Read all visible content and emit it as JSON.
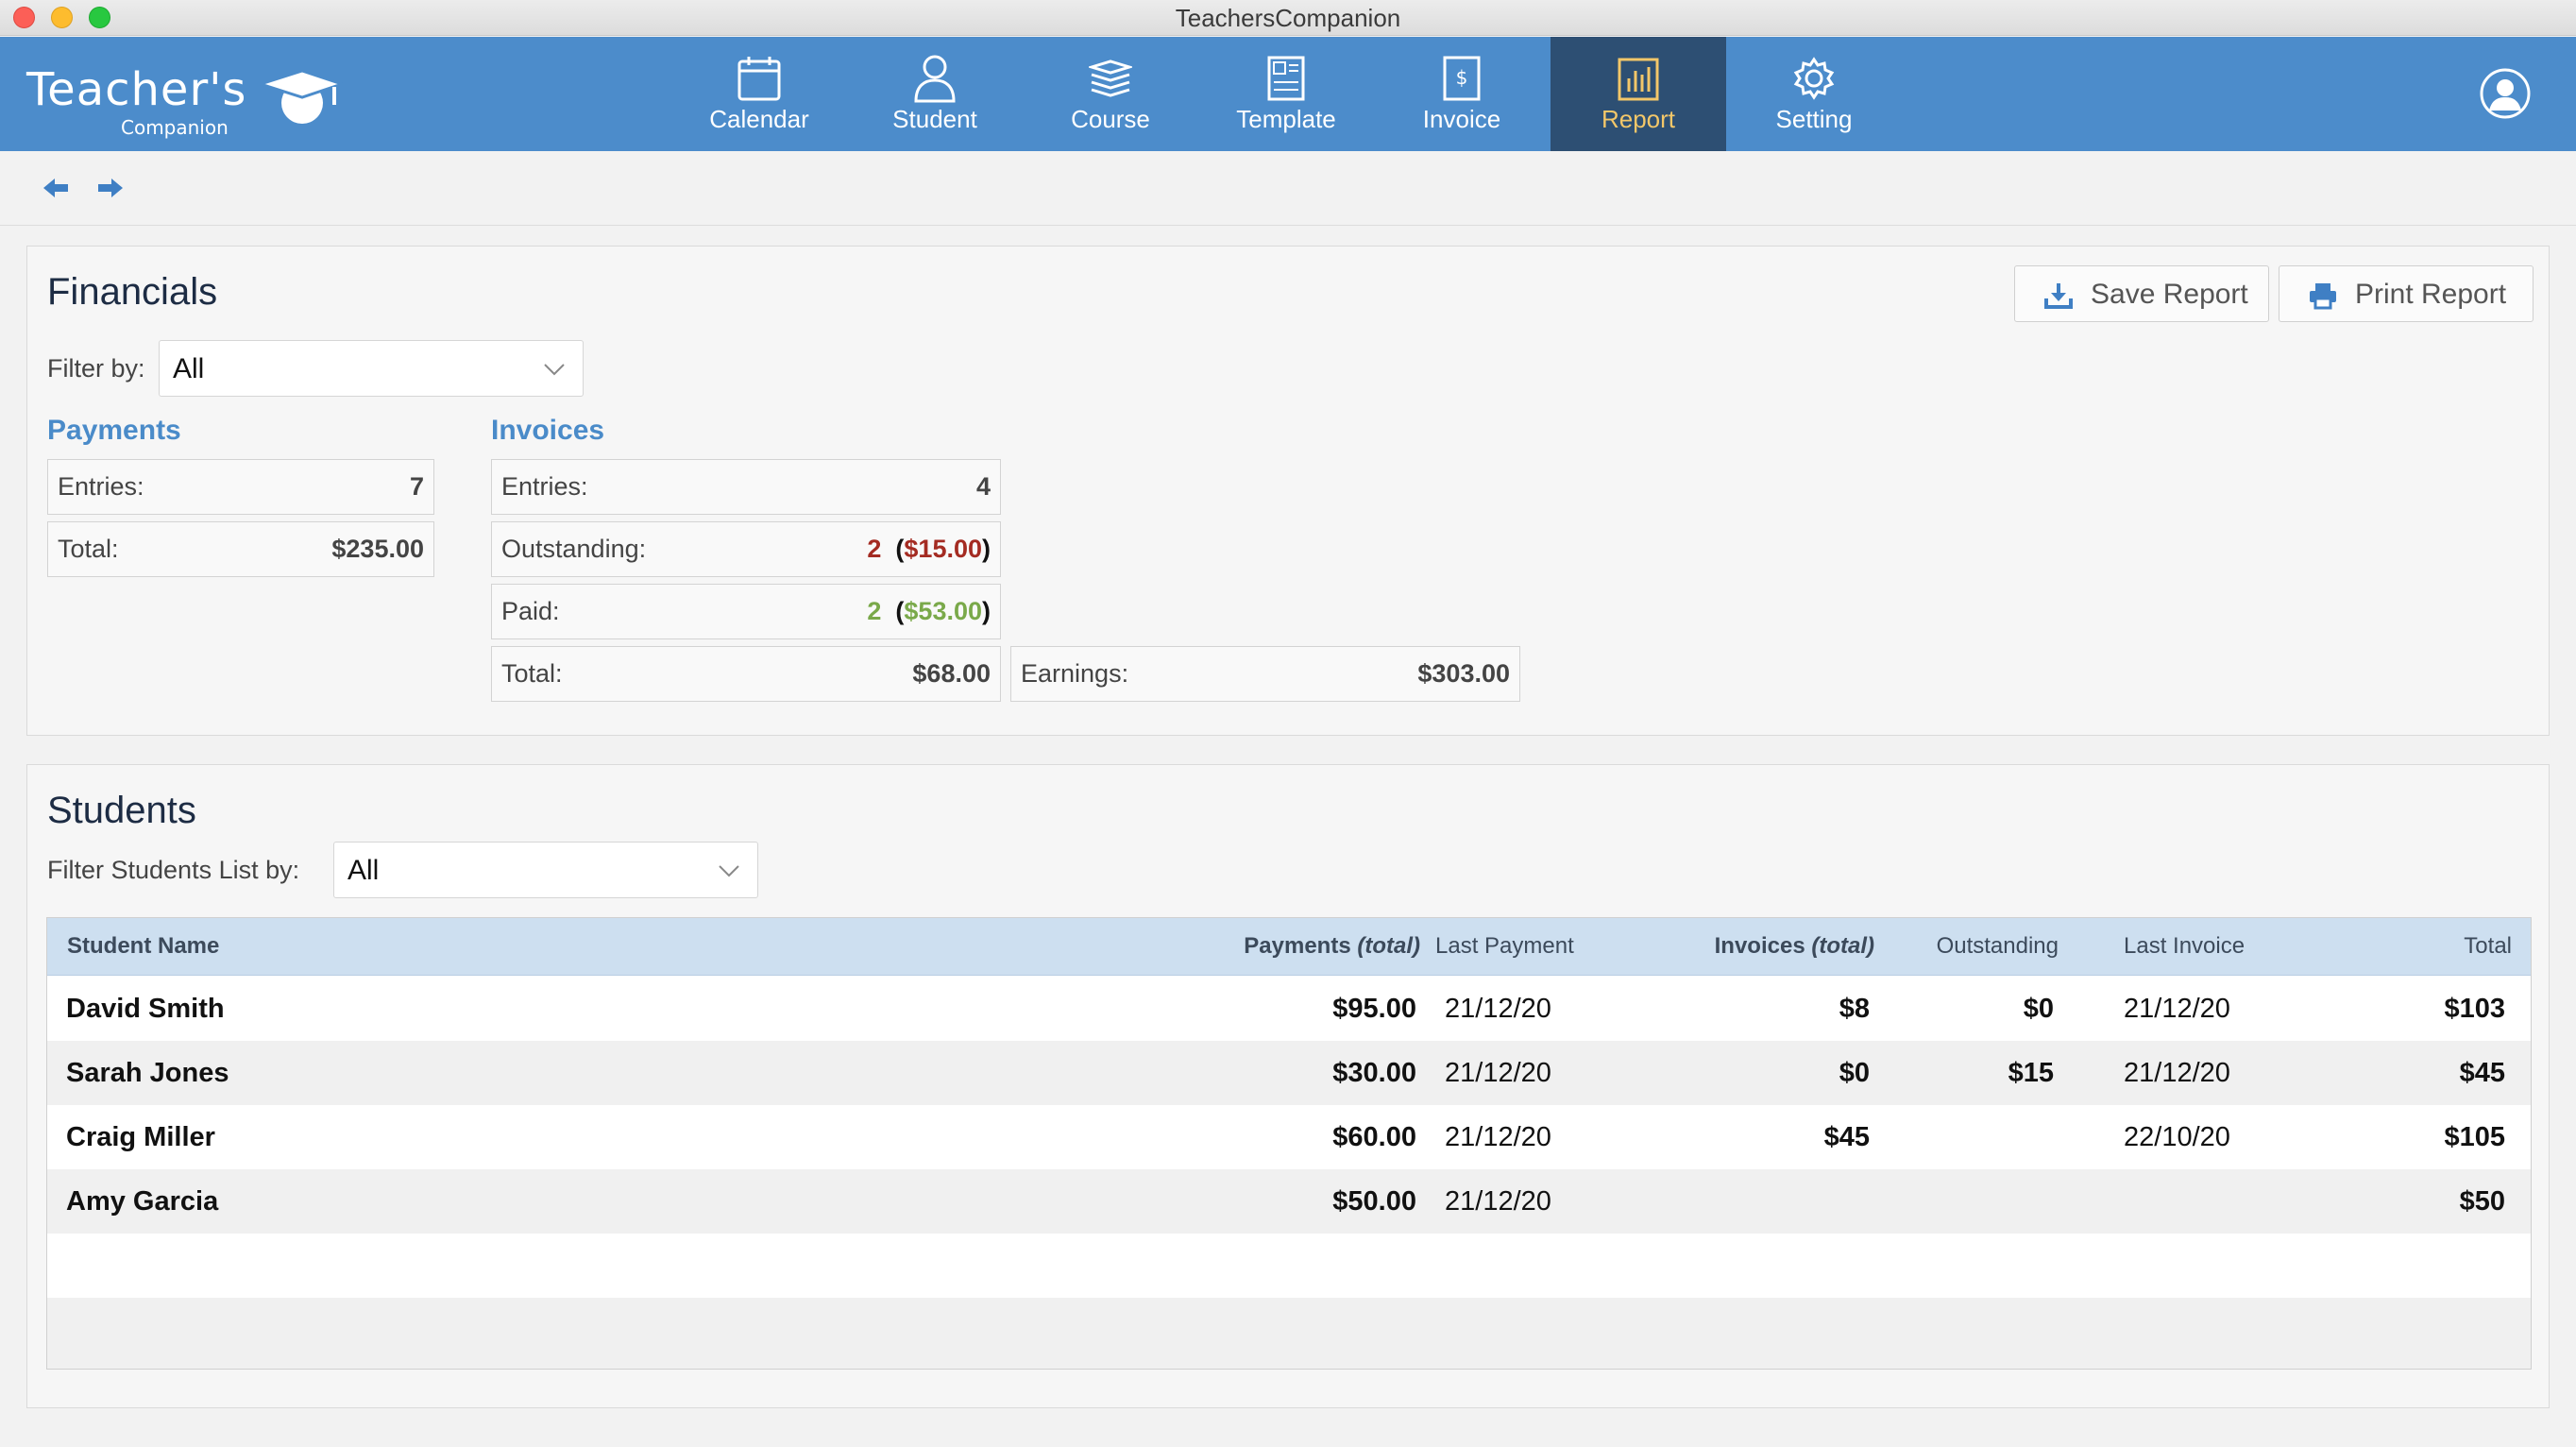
{
  "window": {
    "title": "TeachersCompanion"
  },
  "logo": {
    "main": "Teacher's",
    "sub": "Companion"
  },
  "nav": {
    "items": [
      {
        "label": "Calendar",
        "icon": "calendar-icon"
      },
      {
        "label": "Student",
        "icon": "person-icon"
      },
      {
        "label": "Course",
        "icon": "books-icon"
      },
      {
        "label": "Template",
        "icon": "template-icon"
      },
      {
        "label": "Invoice",
        "icon": "invoice-icon"
      },
      {
        "label": "Report",
        "icon": "bar-chart-icon",
        "active": true
      },
      {
        "label": "Setting",
        "icon": "gear-icon"
      }
    ],
    "active_color": "#2d4f73",
    "bar_color": "#4c8ccb"
  },
  "financials": {
    "title": "Financials",
    "save_label": "Save Report",
    "print_label": "Print Report",
    "filter_label": "Filter by:",
    "filter_value": "All",
    "payments": {
      "heading": "Payments",
      "entries_label": "Entries:",
      "entries_value": "7",
      "total_label": "Total:",
      "total_value": "$235.00"
    },
    "invoices": {
      "heading": "Invoices",
      "entries_label": "Entries:",
      "entries_value": "4",
      "outstanding_label": "Outstanding:",
      "outstanding_count": "2",
      "outstanding_amount": "$15.00",
      "paid_label": "Paid:",
      "paid_count": "2",
      "paid_amount": "$53.00",
      "total_label": "Total:",
      "total_value": "$68.00"
    },
    "earnings_label": "Earnings:",
    "earnings_value": "$303.00"
  },
  "students": {
    "title": "Students",
    "filter_label": "Filter Students List by:",
    "filter_value": "All",
    "columns": {
      "name": "Student Name",
      "payments": "Payments",
      "payments_suffix": "(total)",
      "last_payment": "Last Payment",
      "invoices": "Invoices",
      "invoices_suffix": "(total)",
      "outstanding": "Outstanding",
      "last_invoice": "Last Invoice",
      "total": "Total"
    },
    "rows": [
      {
        "name": "David Smith",
        "payments": "$95.00",
        "last_payment": "21/12/20",
        "invoices": "$8",
        "outstanding": "$0",
        "last_invoice": "21/12/20",
        "total": "$103"
      },
      {
        "name": "Sarah Jones",
        "payments": "$30.00",
        "last_payment": "21/12/20",
        "invoices": "$0",
        "outstanding": "$15",
        "last_invoice": "21/12/20",
        "total": "$45"
      },
      {
        "name": "Craig Miller",
        "payments": "$60.00",
        "last_payment": "21/12/20",
        "invoices": "$45",
        "outstanding": "",
        "last_invoice": "22/10/20",
        "total": "$105"
      },
      {
        "name": "Amy Garcia",
        "payments": "$50.00",
        "last_payment": "21/12/20",
        "invoices": "",
        "outstanding": "",
        "last_invoice": "",
        "total": "$50"
      }
    ]
  }
}
